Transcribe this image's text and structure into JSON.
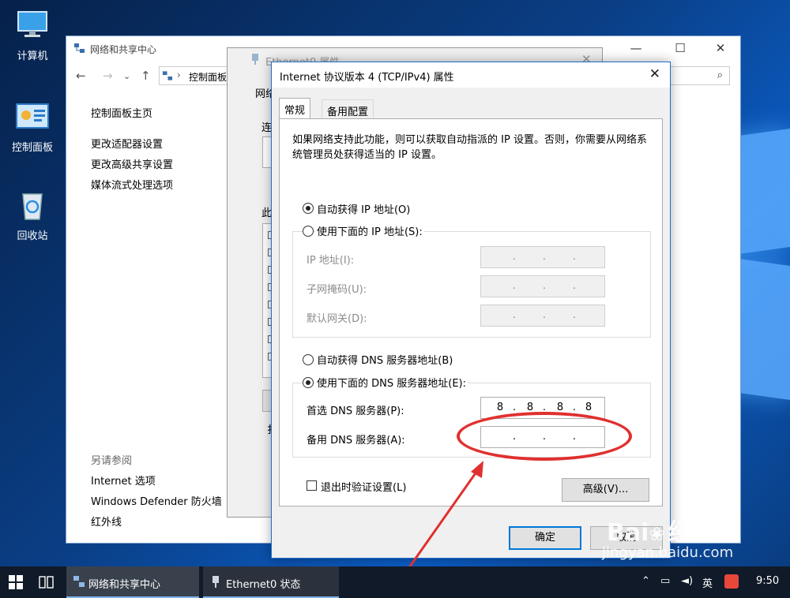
{
  "desktop": {
    "icons": [
      {
        "label": "计算机"
      },
      {
        "label": "控制面板"
      },
      {
        "label": "回收站"
      }
    ]
  },
  "control_panel": {
    "title": "网络和共享中心",
    "address": "控制面板",
    "sidebar_links": [
      "控制面板主页",
      "更改适配器设置",
      "更改高级共享设置",
      "媒体流式处理选项"
    ],
    "see_also_title": "另请参阅",
    "see_also_links": [
      "Internet 选项",
      "Windows Defender 防火墙",
      "红外线"
    ]
  },
  "ethernet_props": {
    "title": "Ethernet0 属性",
    "tab_fragment": "网络",
    "frag1": "连",
    "frag2": "此",
    "frag3": "扌"
  },
  "dialog": {
    "title": "Internet 协议版本 4 (TCP/IPv4) 属性",
    "close_glyph": "✕",
    "tabs": [
      "常规",
      "备用配置"
    ],
    "description": "如果网络支持此功能，则可以获取自动指派的 IP 设置。否则，你需要从网络系统管理员处获得适当的 IP 设置。",
    "ip_auto_label": "自动获得 IP 地址(O)",
    "ip_manual_label": "使用下面的 IP 地址(S):",
    "ip_fields": [
      {
        "label": "IP 地址(I):",
        "octets": [
          "",
          "",
          "",
          ""
        ]
      },
      {
        "label": "子网掩码(U):",
        "octets": [
          "",
          "",
          "",
          ""
        ]
      },
      {
        "label": "默认网关(D):",
        "octets": [
          "",
          "",
          "",
          ""
        ]
      }
    ],
    "dns_auto_label": "自动获得 DNS 服务器地址(B)",
    "dns_manual_label": "使用下面的 DNS 服务器地址(E):",
    "dns_fields": [
      {
        "label": "首选 DNS 服务器(P):",
        "octets": [
          "8",
          "8",
          "8",
          "8"
        ]
      },
      {
        "label": "备用 DNS 服务器(A):",
        "octets": [
          "",
          "",
          "",
          ""
        ]
      }
    ],
    "validate_label": "退出时验证设置(L)",
    "advanced_button": "高级(V)...",
    "ok_button": "确定",
    "cancel_button": "取消"
  },
  "taskbar": {
    "items": [
      "网络和共享中心",
      "Ethernet0 状态"
    ],
    "ime": "英",
    "time": "9:50"
  },
  "watermark": {
    "brand": "Bai",
    "brand2": "经验",
    "url": "jingyan.baidu.com"
  },
  "colors": {
    "annotation": "#e0302f",
    "accent": "#0078d7"
  }
}
